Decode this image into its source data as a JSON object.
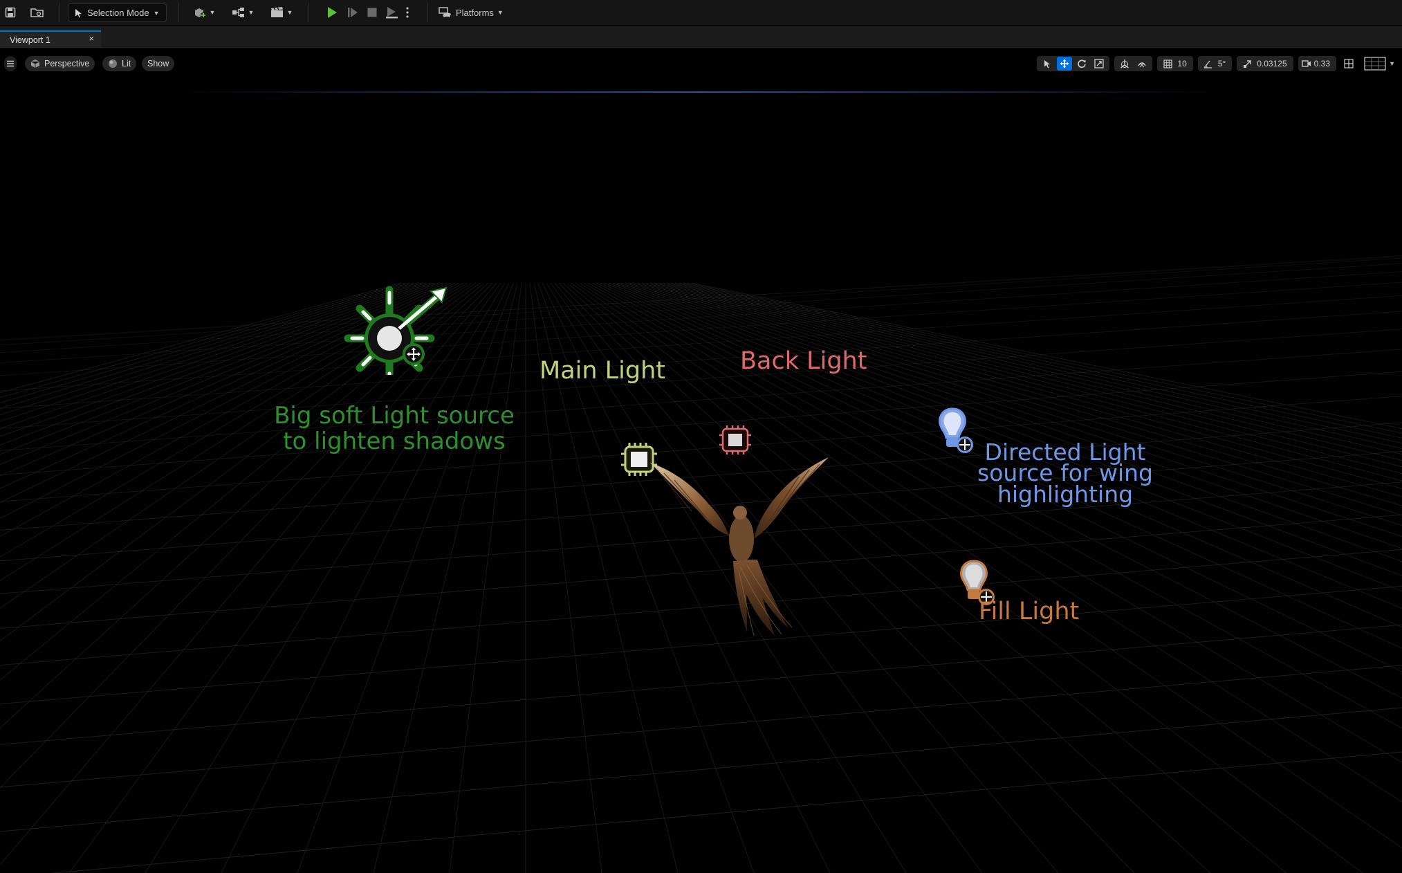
{
  "toolbar": {
    "selection_mode": "Selection Mode",
    "platforms": "Platforms"
  },
  "tabs": {
    "viewport_tab": "Viewport 1",
    "close_glyph": "×"
  },
  "viewport": {
    "view_mode": "Perspective",
    "lighting_mode": "Lit",
    "show_button": "Show",
    "grid_snap_value": "10",
    "rotation_snap_value": "5°",
    "scale_snap_value": "0.03125",
    "camera_speed_value": "0.33"
  },
  "annotations": {
    "soft_light_line1": "Big soft Light source",
    "soft_light_line2": "to lighten shadows",
    "main_light": "Main Light",
    "back_light": "Back Light",
    "directed_line1": "Directed Light",
    "directed_line2": "source for wing",
    "directed_line3": "highlighting",
    "fill_light": "Fill Light"
  },
  "icons": {
    "save": "save-icon",
    "content_browser": "content-browser-icon",
    "add_actor": "add-actor-icon",
    "blueprint": "blueprint-icon",
    "cinematics": "cinematics-icon",
    "play": "play-icon",
    "step": "step-icon",
    "stop": "stop-icon",
    "eject": "eject-icon"
  },
  "colors": {
    "accent_blue": "#0070e0",
    "play_green": "#5fbf3a",
    "soft_light_green": "#2f8f2f",
    "main_light_yellow": "#c1d27a",
    "back_light_red": "#e06a6a",
    "directed_light_blue": "#6f97e6",
    "fill_light_orange": "#c47a3e"
  }
}
